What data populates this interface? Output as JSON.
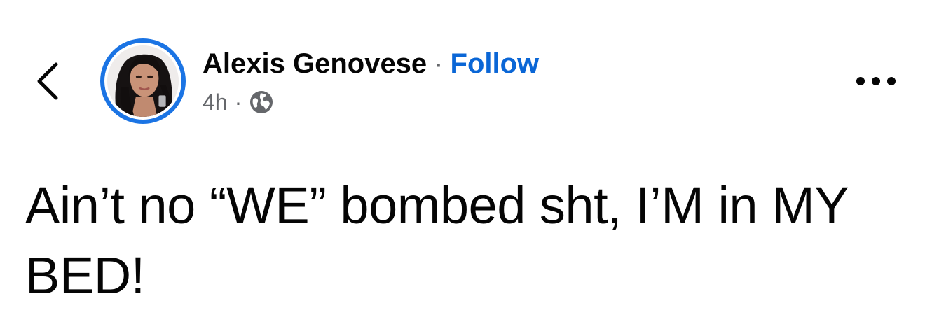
{
  "post": {
    "author": {
      "name": "Alexis Genovese",
      "follow_label": "Follow",
      "separator": "·"
    },
    "meta": {
      "time": "4h",
      "separator": "·",
      "audience_icon": "globe-icon"
    },
    "body_text": "Ain’t no “WE” bombed sht, I’M in MY BED!"
  },
  "icons": {
    "back": "chevron-left-icon",
    "more": "more-horizontal-icon"
  },
  "colors": {
    "accent": "#0a66d6",
    "avatar_ring": "#1b74e4",
    "secondary_text": "#65676b",
    "primary_text": "#050505"
  }
}
